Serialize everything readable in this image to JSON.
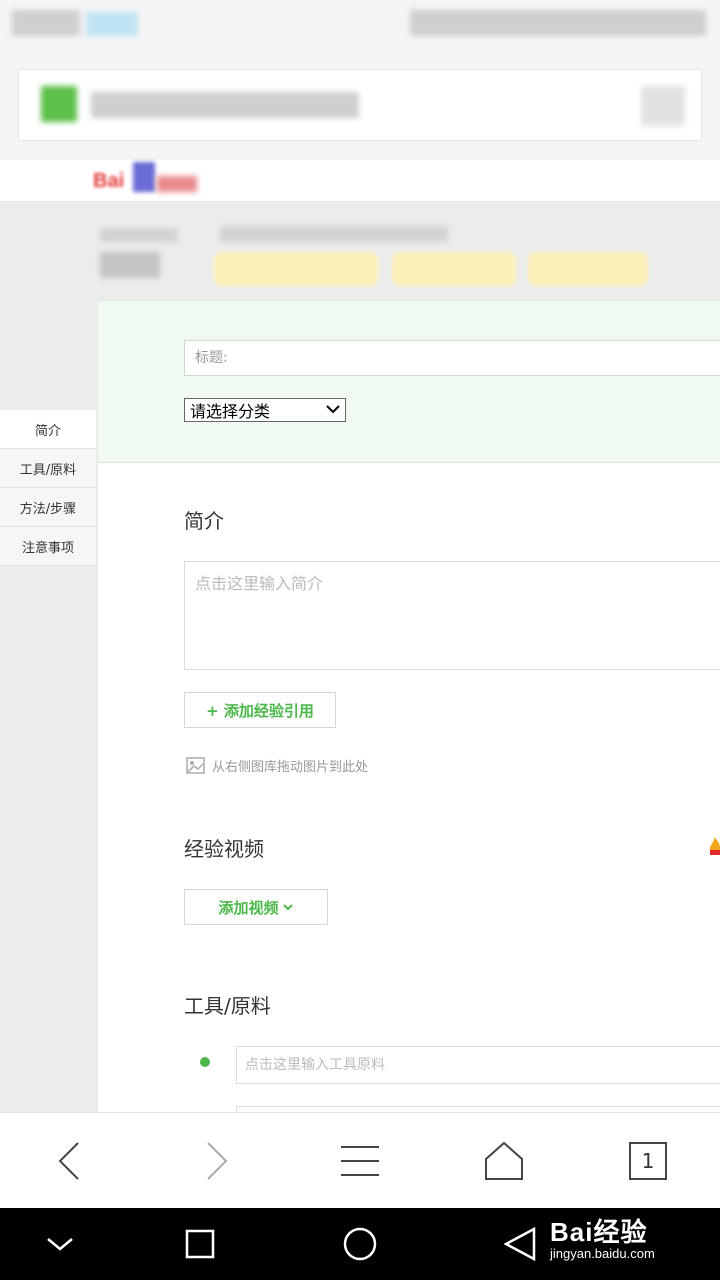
{
  "sidebar": {
    "items": [
      {
        "label": "简介",
        "active": true
      },
      {
        "label": "工具/原料",
        "active": false
      },
      {
        "label": "方法/步骤",
        "active": false
      },
      {
        "label": "注意事项",
        "active": false
      }
    ]
  },
  "editor": {
    "title_placeholder": "标题:",
    "category_selected": "请选择分类",
    "intro_heading": "简介",
    "intro_placeholder": "点击这里输入简介",
    "add_reference_label": "+ 添加经验引用",
    "drag_hint": "从右侧图库拖动图片到此处",
    "video_heading": "经验视频",
    "add_video_label": "添加视频",
    "tools_heading": "工具/原料",
    "tools_placeholder": "点击这里输入工具原料"
  },
  "browser_bar": {
    "tab_count": "1"
  },
  "header": {
    "logo_text": "Bai"
  },
  "watermark": {
    "main": "Bai经验",
    "sub": "jingyan.baidu.com"
  },
  "colors": {
    "accent_green": "#4cb84a",
    "title_section_bg": "#f1faf0",
    "page_gray": "#ececec"
  }
}
